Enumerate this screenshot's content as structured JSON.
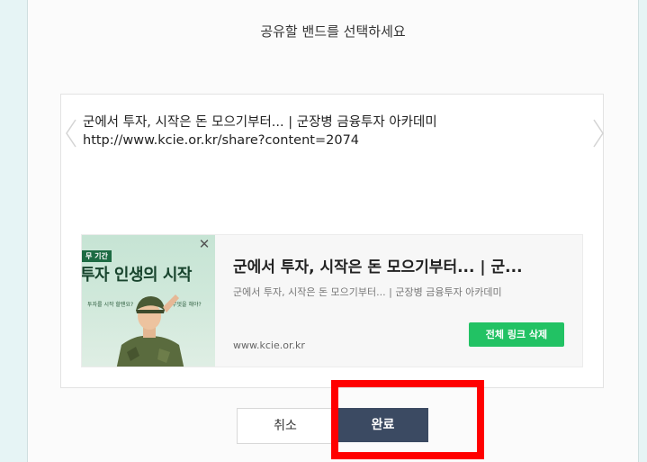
{
  "dialog": {
    "title": "공유할 밴드를 선택하세요",
    "message_line1": "군에서 투자, 시작은 돈 모으기부터... | 군장병 금융투자 아카데미",
    "message_line2": "http://www.kcie.or.kr/share?content=2074"
  },
  "preview_card": {
    "thumbnail_tag": "무 기간",
    "thumbnail_headline": "투자 인생의 시작",
    "thumbnail_small_left": "투자를 시작 할땐요?",
    "thumbnail_small_right": "무엇을 해야?",
    "title": "군에서 투자, 시작은 돈 모으기부터... | 군...",
    "description": "군에서 투자, 시작은 돈 모으기부터... | 군장병 금융투자 아카데미",
    "url": "www.kcie.or.kr",
    "remove_link_label": "전체 링크 삭제"
  },
  "buttons": {
    "cancel_label": "취소",
    "ok_label": "완료"
  },
  "colors": {
    "background": "#e6f4f5",
    "ok_button": "#3b4a62",
    "delete_button": "#22c264",
    "highlight": "#ff0000"
  },
  "icons": [
    "chevron-left-icon",
    "chevron-right-icon",
    "close-icon"
  ]
}
